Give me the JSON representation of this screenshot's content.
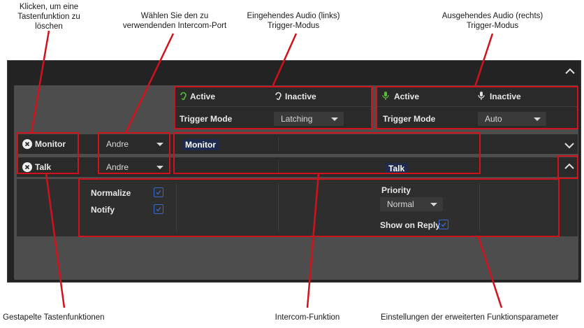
{
  "annotations": {
    "delete": "Klicken, um eine\nTastenfunktion zu\nlöschen",
    "port": "Wählen Sie den zu\nverwendenden Intercom-Port",
    "incoming": "Eingehendes Audio (links)\nTrigger-Modus",
    "outgoing": "Ausgehendes Audio (rechts)\nTrigger-Modus",
    "stacked": "Gestapelte Tastenfunktionen",
    "intercom": "Intercom-Funktion",
    "advanced": "Einstellungen der erweiterten Funktionsparameter"
  },
  "incoming_audio": {
    "active_label": "Active",
    "inactive_label": "Inactive",
    "trigger_mode_label": "Trigger Mode",
    "trigger_mode_value": "Latching"
  },
  "outgoing_audio": {
    "active_label": "Active",
    "inactive_label": "Inactive",
    "trigger_mode_label": "Trigger Mode",
    "trigger_mode_value": "Auto"
  },
  "keys": [
    {
      "name": "Monitor",
      "port": "Andre",
      "function": "Monitor"
    },
    {
      "name": "Talk",
      "port": "Andre",
      "function": "Talk"
    }
  ],
  "advanced": {
    "normalize_label": "Normalize",
    "notify_label": "Notify",
    "priority_label": "Priority",
    "priority_value": "Normal",
    "show_on_reply_label": "Show on Reply"
  },
  "colors": {
    "accent_green": "#5bbf3a",
    "annotation_red": "#d0121b",
    "checkbox_blue": "#3a69c9"
  }
}
